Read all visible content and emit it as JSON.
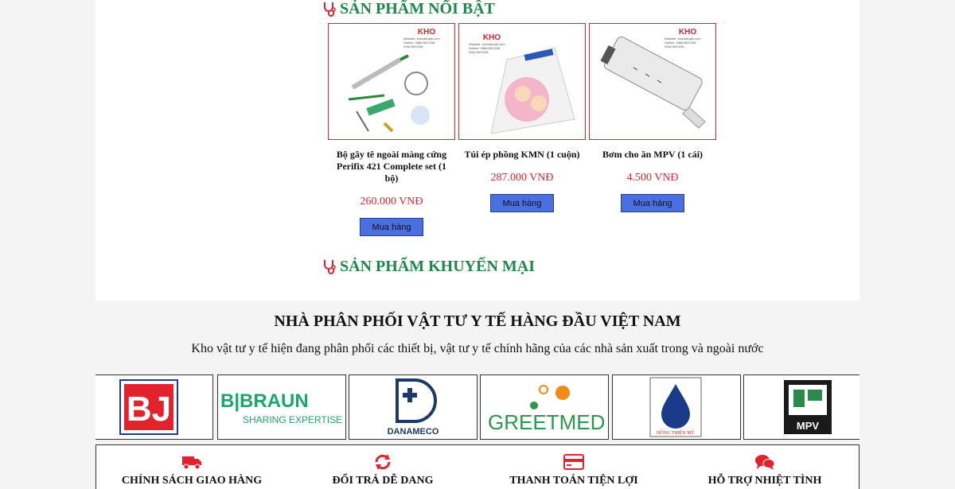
{
  "featured": {
    "title": "SẢN PHẨM NỔI BẬT",
    "logo": {
      "brand": "KHO",
      "lines": [
        "vật tư y tế",
        "Website: khovattuyte.com",
        "Hotline: 0888.863.638",
        "0962.869.638"
      ]
    },
    "products": [
      {
        "name": "Bộ gây tê ngoài màng cứng Perifix 421 Complete set (1 bộ)",
        "price": "260.000 VNĐ",
        "button": "Mua hàng",
        "icon": "anesthesia-kit-image"
      },
      {
        "name": "Túi ép phồng KMN (1 cuộn)",
        "price": "287.000 VNĐ",
        "button": "Mua hàng",
        "icon": "sterilization-pouch-image"
      },
      {
        "name": "Bơm cho ăn MPV (1 cái)",
        "price": "4.500 VNĐ",
        "button": "Mua hàng",
        "icon": "feeding-syringe-image"
      }
    ]
  },
  "promo": {
    "title": "SẢN PHẨM KHUYẾN MẠI"
  },
  "distributor": {
    "title": "NHÀ PHÂN PHỐI VẬT TƯ Y TẾ HÀNG ĐẦU VIỆT NAM",
    "description": "Kho vật tư y tế hiện đang phân phối các thiết bị, vật tư y tế chính hãng của các nhà sản xuất trong và ngoài nước"
  },
  "brands": [
    {
      "name": "BJ",
      "logo": "bj-logo"
    },
    {
      "name": "B|BRAUN",
      "tagline": "SHARING EXPERTISE",
      "logo": "bbraun-logo"
    },
    {
      "name": "DANAMECO",
      "logo": "danameco-logo"
    },
    {
      "name": "GREETMED",
      "logo": "greetmed-logo"
    },
    {
      "name": "HỒNG THIỆN MỸ",
      "logo": "hong-thien-my-logo"
    },
    {
      "name": "MPV",
      "logo": "mpv-logo"
    }
  ],
  "features": [
    {
      "label": "CHÍNH SÁCH GIAO HÀNG",
      "icon": "truck-icon"
    },
    {
      "label": "ĐỔI TRẢ DỄ DANG",
      "icon": "refresh-icon"
    },
    {
      "label": "THANH TOÁN TIỆN LỢI",
      "icon": "credit-card-icon"
    },
    {
      "label": "HỖ TRỢ NHIỆT TÌNH",
      "icon": "chat-bubbles-icon"
    }
  ],
  "colors": {
    "accent_green": "#1a8a4a",
    "price_red": "#e2222d",
    "button_blue": "#4a6fe0"
  }
}
